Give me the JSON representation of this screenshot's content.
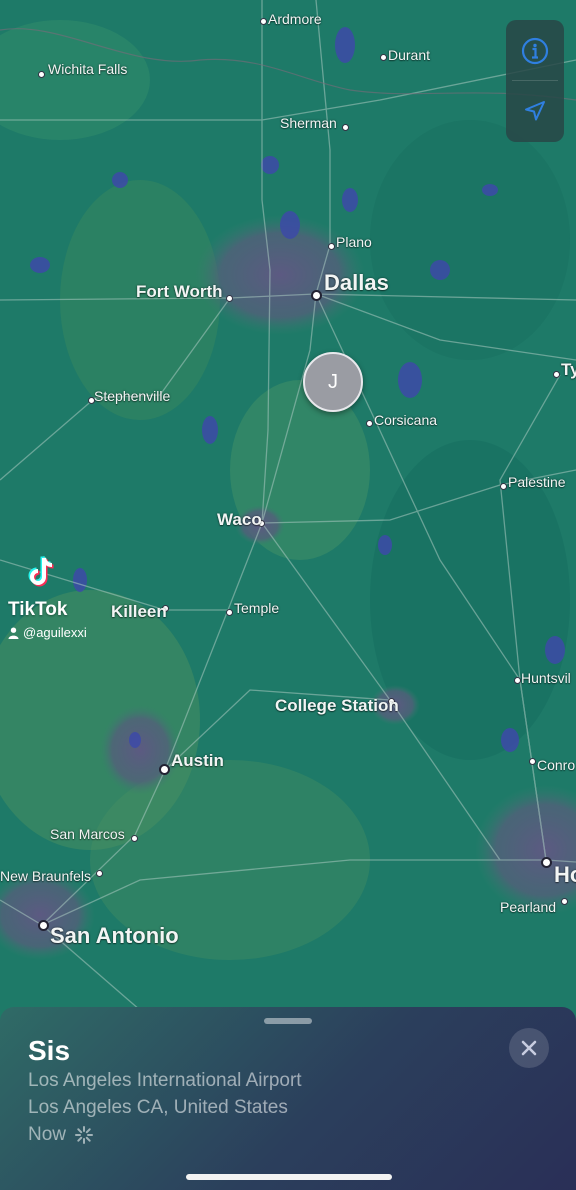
{
  "map": {
    "cities": [
      {
        "id": "ardmore",
        "label": "Ardmore",
        "size": "small"
      },
      {
        "id": "durant",
        "label": "Durant",
        "size": "small"
      },
      {
        "id": "wichita-falls",
        "label": "Wichita Falls",
        "size": "small"
      },
      {
        "id": "sherman",
        "label": "Sherman",
        "size": "small"
      },
      {
        "id": "plano",
        "label": "Plano",
        "size": "small"
      },
      {
        "id": "dallas",
        "label": "Dallas",
        "size": "huge"
      },
      {
        "id": "fort-worth",
        "label": "Fort Worth",
        "size": "big"
      },
      {
        "id": "tyler",
        "label": "Ty",
        "size": "small"
      },
      {
        "id": "stephenville",
        "label": "Stephenville",
        "size": "small"
      },
      {
        "id": "corsicana",
        "label": "Corsicana",
        "size": "small"
      },
      {
        "id": "palestine",
        "label": "Palestine",
        "size": "small"
      },
      {
        "id": "waco",
        "label": "Waco",
        "size": "big"
      },
      {
        "id": "killeen",
        "label": "Killeen",
        "size": "small"
      },
      {
        "id": "temple",
        "label": "Temple",
        "size": "small"
      },
      {
        "id": "huntsville",
        "label": "Huntsvil",
        "size": "small"
      },
      {
        "id": "college-station",
        "label": "College Station",
        "size": "big"
      },
      {
        "id": "austin",
        "label": "Austin",
        "size": "big"
      },
      {
        "id": "conroe",
        "label": "Conro",
        "size": "small"
      },
      {
        "id": "san-marcos",
        "label": "San Marcos",
        "size": "small"
      },
      {
        "id": "new-braunfels",
        "label": "New Braunfels",
        "size": "small"
      },
      {
        "id": "houston",
        "label": "Ho",
        "size": "huge"
      },
      {
        "id": "pearland",
        "label": "Pearland",
        "size": "small"
      },
      {
        "id": "san-antonio",
        "label": "San Antonio",
        "size": "huge"
      }
    ],
    "pin_initial": "J",
    "controls": {
      "info_icon": "info-icon",
      "location_icon": "location-arrow-icon"
    }
  },
  "watermark": {
    "name": "TikTok",
    "handle": "@aguilexxi"
  },
  "sheet": {
    "title": "Sis",
    "place": "Los Angeles International Airport",
    "region": "Los Angeles CA, United States",
    "time": "Now"
  }
}
